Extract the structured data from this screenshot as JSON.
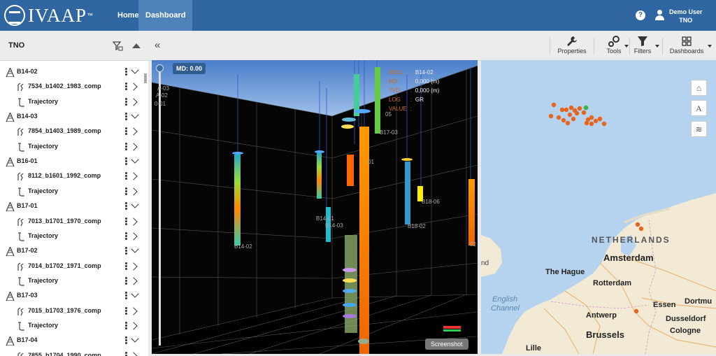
{
  "app": {
    "logo_text": "IVAAP",
    "logo_tm": "™"
  },
  "nav": {
    "home": "Home",
    "dashboard": "Dashboard"
  },
  "header": {
    "help": "?",
    "user_name": "Demo User",
    "user_org": "TNO"
  },
  "sidebar": {
    "title": "TNO",
    "items": [
      {
        "kind": "well",
        "label": "B14-02"
      },
      {
        "kind": "log",
        "label": "7534_b1402_1983_comp"
      },
      {
        "kind": "traj",
        "label": "Trajectory"
      },
      {
        "kind": "well",
        "label": "B14-03"
      },
      {
        "kind": "log",
        "label": "7854_b1403_1989_comp"
      },
      {
        "kind": "traj",
        "label": "Trajectory"
      },
      {
        "kind": "well",
        "label": "B16-01"
      },
      {
        "kind": "log",
        "label": "8112_b1601_1992_comp"
      },
      {
        "kind": "traj",
        "label": "Trajectory"
      },
      {
        "kind": "well",
        "label": "B17-01"
      },
      {
        "kind": "log",
        "label": "7013_b1701_1970_comp"
      },
      {
        "kind": "traj",
        "label": "Trajectory"
      },
      {
        "kind": "well",
        "label": "B17-02"
      },
      {
        "kind": "log",
        "label": "7014_b1702_1971_comp"
      },
      {
        "kind": "traj",
        "label": "Trajectory"
      },
      {
        "kind": "well",
        "label": "B17-03"
      },
      {
        "kind": "log",
        "label": "7015_b1703_1976_comp"
      },
      {
        "kind": "traj",
        "label": "Trajectory"
      },
      {
        "kind": "well",
        "label": "B17-04"
      },
      {
        "kind": "log",
        "label": "7855_b1704_1990_comp"
      }
    ]
  },
  "toolbar": {
    "collapse": "«",
    "properties": "Properties",
    "tools": "Tools",
    "filters": "Filters",
    "dashboards": "Dashboards"
  },
  "viewer": {
    "md_badge": "MD: 0.00",
    "screenshot": "Screenshot",
    "info": [
      {
        "key": "WELL",
        "value": "B14-02"
      },
      {
        "key": "MD",
        "value": "0,000 (m)"
      },
      {
        "key": "TVD",
        "value": "0,000 (m)"
      },
      {
        "key": "LOG",
        "value": "GR"
      },
      {
        "key": "VALUE",
        "value": ""
      }
    ],
    "well_labels": [
      "A-03",
      "A-02",
      "0-01",
      "B14-02",
      "B14-01",
      "B14-03",
      "05",
      "B17-03",
      "01",
      "B18-06",
      "B18-02",
      "02"
    ]
  },
  "map": {
    "labels": {
      "netherlands": "NETHERLANDS",
      "amsterdam": "Amsterdam",
      "the_hague": "The Hague",
      "rotterdam": "Rotterdam",
      "english_channel_1": "English",
      "english_channel_2": "Channel",
      "antwerp": "Antwerp",
      "brussels": "Brussels",
      "essen": "Essen",
      "dortmund": "Dortmu",
      "dusseldorf": "Dusseldorf",
      "cologne": "Cologne",
      "lille": "Lille",
      "nd": "nd"
    },
    "controls": {
      "home": "⌂",
      "text": "A",
      "layers": "≋"
    },
    "colors": {
      "well_marker": "#e8641c",
      "selected_marker": "#3cb24a",
      "sea": "#b5d3ee",
      "land": "#f3ead6"
    }
  }
}
